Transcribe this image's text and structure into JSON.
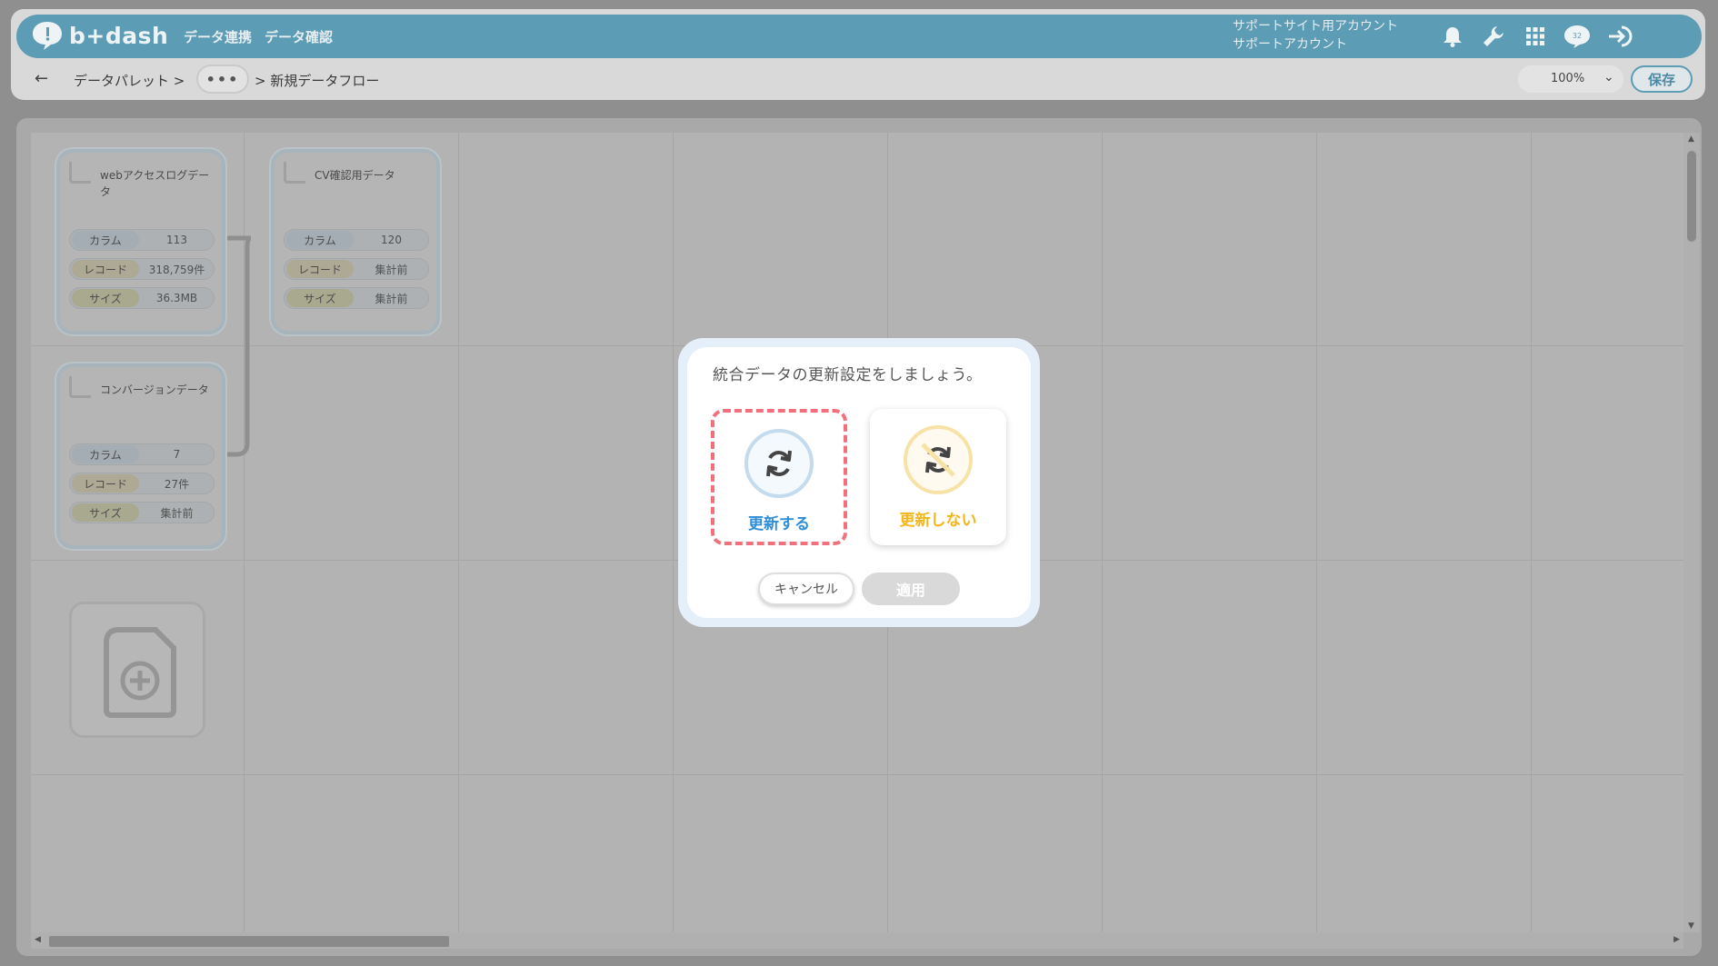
{
  "header": {
    "logo_text": "b+dash",
    "nav": [
      "データ連携",
      "データ確認"
    ],
    "account_line1": "サポートサイト用アカウント",
    "account_line2": "サポートアカウント",
    "notification_count": "32"
  },
  "toolbar": {
    "crumb_root": "データパレット >",
    "more": "•••",
    "crumb_current": "> 新規データフロー",
    "zoom": "100%",
    "save_label": "保存"
  },
  "cards": [
    {
      "title": "webアクセスログデータ",
      "column_label": "カラム",
      "column_value": "113",
      "record_label": "レコード",
      "record_value": "318,759件",
      "size_label": "サイズ",
      "size_value": "36.3MB"
    },
    {
      "title": "CV確認用データ",
      "column_label": "カラム",
      "column_value": "120",
      "record_label": "レコード",
      "record_value": "集計前",
      "size_label": "サイズ",
      "size_value": "集計前"
    },
    {
      "title": "コンバージョンデータ",
      "column_label": "カラム",
      "column_value": "7",
      "record_label": "レコード",
      "record_value": "27件",
      "size_label": "サイズ",
      "size_value": "集計前"
    }
  ],
  "modal": {
    "title": "統合データの更新設定をしましょう。",
    "option_update": "更新する",
    "option_no_update": "更新しない",
    "cancel_label": "キャンセル",
    "apply_label": "適用"
  },
  "colors": {
    "header_bg": "#5d9cb5",
    "update_blue": "#2f8ed8",
    "no_update_yellow": "#f2b61b",
    "selected_border": "#f2707c"
  }
}
